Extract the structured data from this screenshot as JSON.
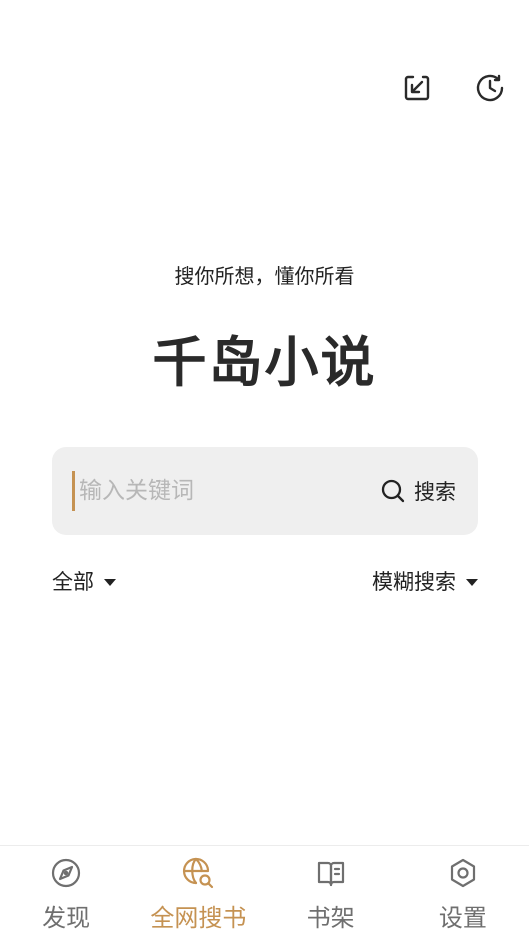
{
  "colors": {
    "accent": "#c59252",
    "inactive": "#6f6f6f",
    "text": "#222222",
    "search_bg": "#efefef"
  },
  "header": {
    "icons": [
      "import-icon",
      "history-icon"
    ]
  },
  "hero": {
    "tagline": "搜你所想，懂你所看",
    "title": "千岛小说"
  },
  "search": {
    "placeholder": "输入关键词",
    "value": "",
    "button_label": "搜索",
    "button_icon": "search-icon"
  },
  "filters": {
    "scope": "全部",
    "mode": "模糊搜索"
  },
  "bottom_nav": {
    "active_index": 1,
    "items": [
      {
        "label": "发现",
        "icon": "compass-icon"
      },
      {
        "label": "全网搜书",
        "icon": "globe-search-icon"
      },
      {
        "label": "书架",
        "icon": "book-icon"
      },
      {
        "label": "设置",
        "icon": "gear-icon"
      }
    ]
  }
}
